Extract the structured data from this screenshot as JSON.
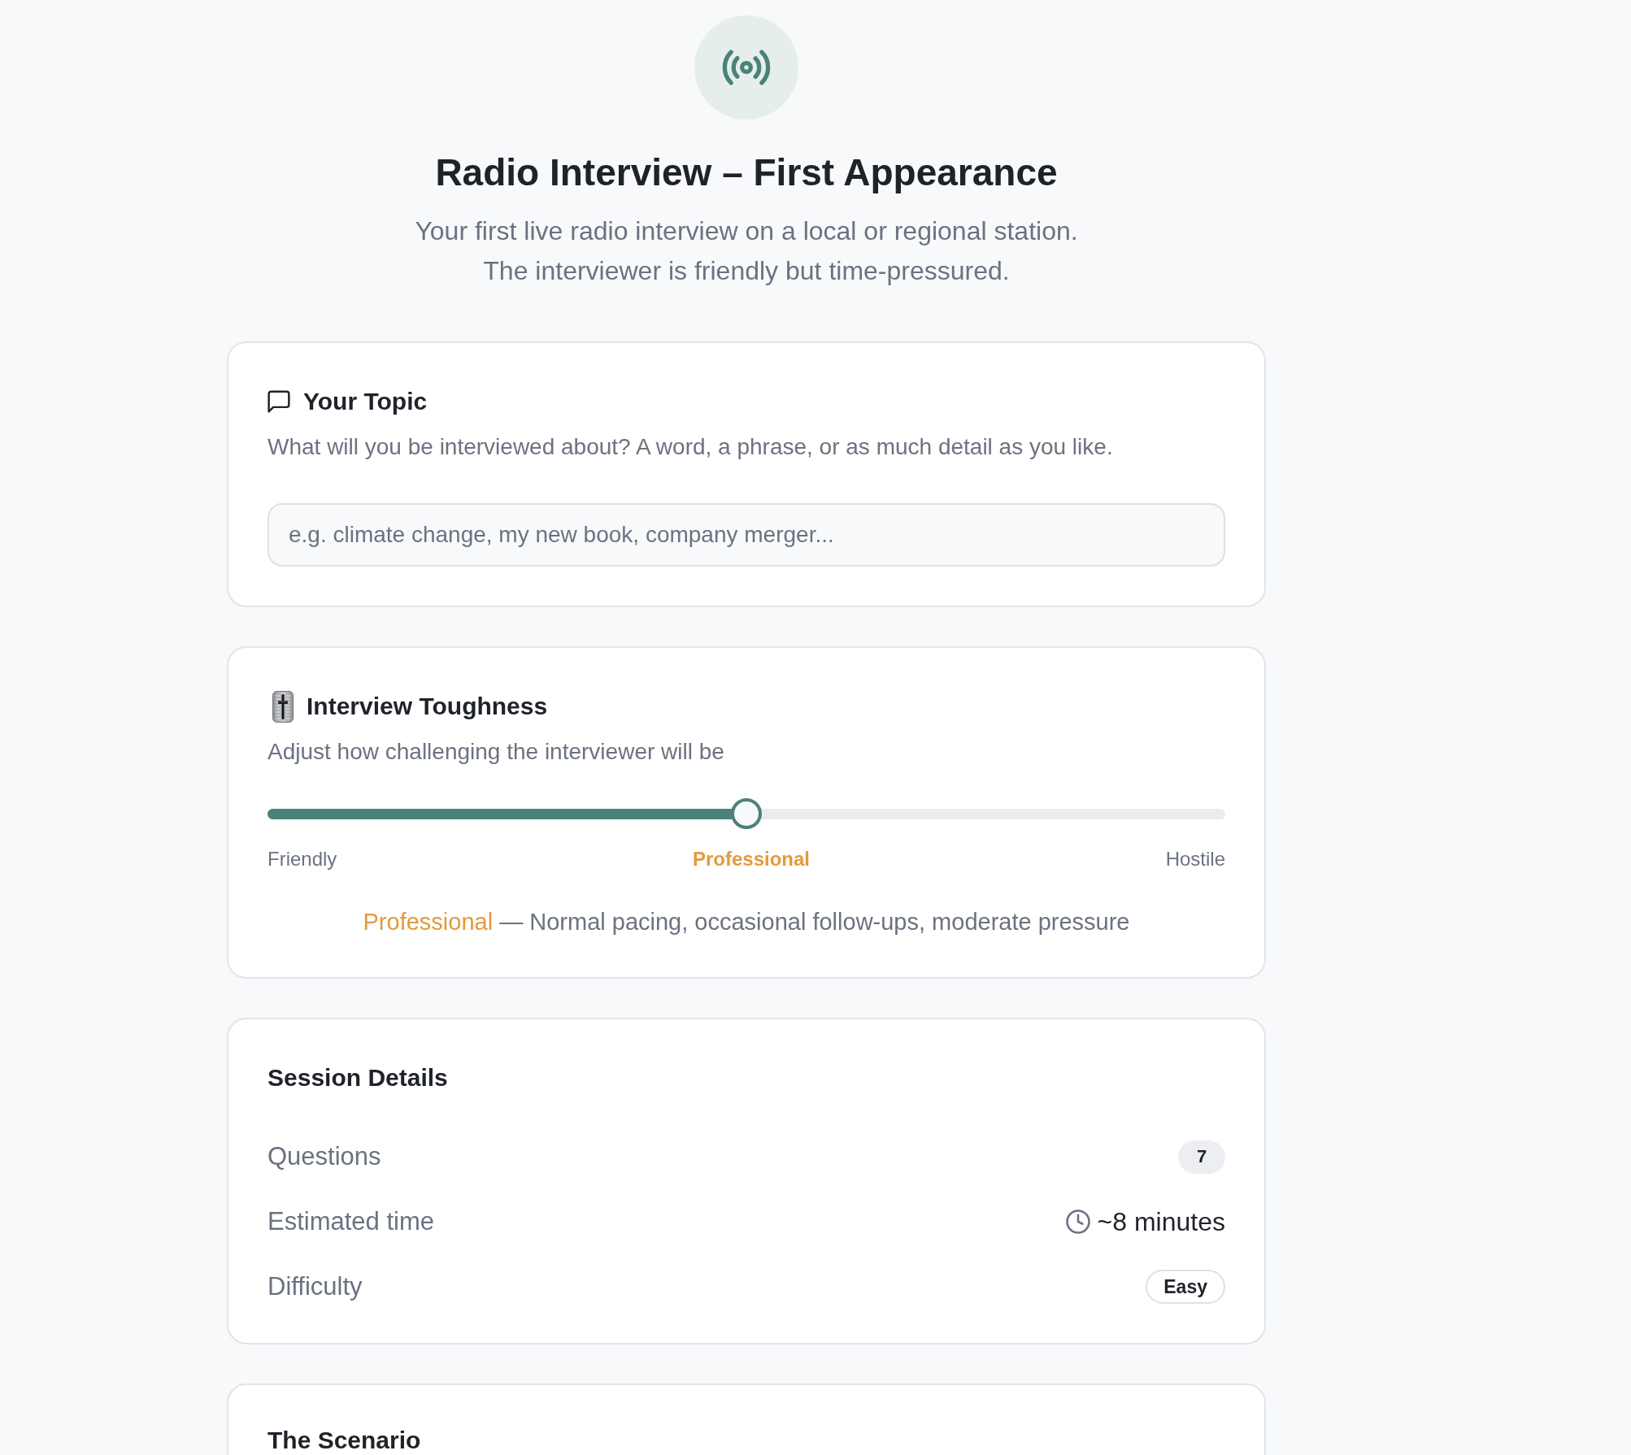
{
  "header": {
    "title": "Radio Interview – First Appearance",
    "subtitle": "Your first live radio interview on a local or regional station. The interviewer is friendly but time-pressured."
  },
  "topic_card": {
    "title": "Your Topic",
    "description": "What will you be interviewed about? A word, a phrase, or as much detail as you like.",
    "input": {
      "placeholder": "e.g. climate change, my new book, company merger..."
    }
  },
  "toughness_card": {
    "title": "Interview Toughness",
    "description": "Adjust how challenging the interviewer will be",
    "slider": {
      "level": 0.5
    },
    "scale_labels": [
      {
        "label": "Friendly",
        "selected": false
      },
      {
        "label": "Professional",
        "selected": true
      },
      {
        "label": "Hostile",
        "selected": false
      }
    ],
    "summary": {
      "level_name": "Professional",
      "text": "— Normal pacing, occasional follow-ups, moderate pressure"
    }
  },
  "session_card": {
    "title": "Session Details",
    "rows": [
      {
        "label": "Questions",
        "kind": "count",
        "value": "7"
      },
      {
        "label": "Estimated time",
        "kind": "duration",
        "value": "~8 minutes"
      },
      {
        "label": "Difficulty",
        "kind": "tag",
        "value": "Easy"
      }
    ]
  },
  "scenario_card": {
    "title": "The Scenario"
  }
}
